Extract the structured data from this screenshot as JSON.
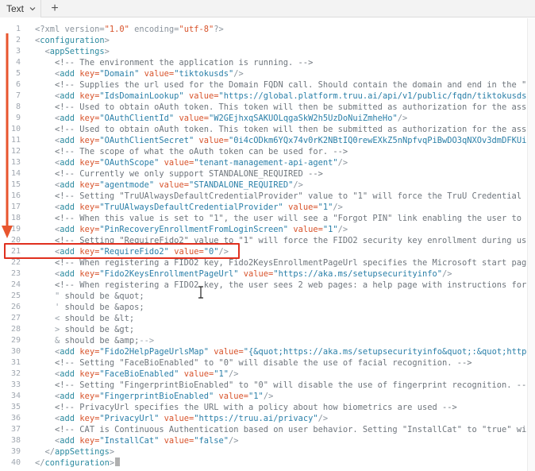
{
  "tab": {
    "label": "Text",
    "add_label": "+"
  },
  "colors": {
    "annotation": "#e0301e",
    "tag": "#2b8aa0",
    "attr": "#d8532b",
    "value": "#2a7fa8"
  },
  "editor": {
    "lines": [
      {
        "n": "1",
        "tokens": [
          {
            "c": "decl",
            "t": "<?xml version="
          },
          {
            "c": "str",
            "t": "\"1.0\""
          },
          {
            "c": "decl",
            "t": " encoding="
          },
          {
            "c": "str",
            "t": "\"utf-8\""
          },
          {
            "c": "decl",
            "t": "?>"
          }
        ]
      },
      {
        "n": "2",
        "tokens": [
          {
            "c": "punc",
            "t": "<"
          },
          {
            "c": "tag",
            "t": "configuration"
          },
          {
            "c": "punc",
            "t": ">"
          }
        ]
      },
      {
        "n": "3",
        "tokens": [
          {
            "c": "punc",
            "t": "  <"
          },
          {
            "c": "tag",
            "t": "appSettings"
          },
          {
            "c": "punc",
            "t": ">"
          }
        ]
      },
      {
        "n": "4",
        "tokens": [
          {
            "c": "comment",
            "t": "    <!-- The environment the application is running. -->"
          }
        ]
      },
      {
        "n": "5",
        "tokens": [
          {
            "c": "punc",
            "t": "    <"
          },
          {
            "c": "tag",
            "t": "add"
          },
          {
            "c": "attr",
            "t": " key="
          },
          {
            "c": "val",
            "t": "\"Domain\""
          },
          {
            "c": "attr",
            "t": " value="
          },
          {
            "c": "val",
            "t": "\"tiktokusds\""
          },
          {
            "c": "punc",
            "t": "/>"
          }
        ]
      },
      {
        "n": "6",
        "tokens": [
          {
            "c": "comment",
            "t": "    <!-- Supplies the url used for the Domain FQDN call. Should contain the domain and end in the \""
          }
        ]
      },
      {
        "n": "7",
        "tokens": [
          {
            "c": "punc",
            "t": "    <"
          },
          {
            "c": "tag",
            "t": "add"
          },
          {
            "c": "attr",
            "t": " key="
          },
          {
            "c": "val",
            "t": "\"IdsDomainLookup\""
          },
          {
            "c": "attr",
            "t": " value="
          },
          {
            "c": "val",
            "t": "\"https://global.platform.truu.ai/api/v1/public/fqdn/tiktokusds"
          }
        ]
      },
      {
        "n": "8",
        "tokens": [
          {
            "c": "comment",
            "t": "    <!-- Used to obtain oAuth token. This token will then be submitted as authorization for the ass"
          }
        ]
      },
      {
        "n": "9",
        "tokens": [
          {
            "c": "punc",
            "t": "    <"
          },
          {
            "c": "tag",
            "t": "add"
          },
          {
            "c": "attr",
            "t": " key="
          },
          {
            "c": "val",
            "t": "\"OAuthClientId\""
          },
          {
            "c": "attr",
            "t": " value="
          },
          {
            "c": "val",
            "t": "\"W2GEjhxqSAKUOLqgaSkW2h5UzDoNuiZmheHo\""
          },
          {
            "c": "punc",
            "t": "/>"
          }
        ]
      },
      {
        "n": "10",
        "tokens": [
          {
            "c": "comment",
            "t": "    <!-- Used to obtain oAuth token. This token will then be submitted as authorization for the ass"
          }
        ]
      },
      {
        "n": "11",
        "tokens": [
          {
            "c": "punc",
            "t": "    <"
          },
          {
            "c": "tag",
            "t": "add"
          },
          {
            "c": "attr",
            "t": " key="
          },
          {
            "c": "val",
            "t": "\"OAuthClientSecret\""
          },
          {
            "c": "attr",
            "t": " value="
          },
          {
            "c": "val",
            "t": "\"0i4cODkm6YQx74v0rK2NBtIQ0rewEXkZ5nNpfvqPiBwDO3qNXOv3dmDFKUi"
          }
        ]
      },
      {
        "n": "12",
        "tokens": [
          {
            "c": "comment",
            "t": "    <!-- The scope of what the oAuth token can be used for. -->"
          }
        ]
      },
      {
        "n": "13",
        "tokens": [
          {
            "c": "punc",
            "t": "    <"
          },
          {
            "c": "tag",
            "t": "add"
          },
          {
            "c": "attr",
            "t": " key="
          },
          {
            "c": "val",
            "t": "\"OAuthScope\""
          },
          {
            "c": "attr",
            "t": " value="
          },
          {
            "c": "val",
            "t": "\"tenant-management-api-agent\""
          },
          {
            "c": "punc",
            "t": "/>"
          }
        ]
      },
      {
        "n": "14",
        "tokens": [
          {
            "c": "comment",
            "t": "    <!-- Currently we only support STANDALONE_REQUIRED -->"
          }
        ]
      },
      {
        "n": "15",
        "tokens": [
          {
            "c": "punc",
            "t": "    <"
          },
          {
            "c": "tag",
            "t": "add"
          },
          {
            "c": "attr",
            "t": " key="
          },
          {
            "c": "val",
            "t": "\"agentmode\""
          },
          {
            "c": "attr",
            "t": " value="
          },
          {
            "c": "val",
            "t": "\"STANDALONE_REQUIRED\""
          },
          {
            "c": "punc",
            "t": "/>"
          }
        ]
      },
      {
        "n": "16",
        "tokens": [
          {
            "c": "comment",
            "t": "    <!-- Setting \"TruUAlwaysDefaultCredentialProvider\" value to \"1\" will force the TruU Credential P"
          }
        ]
      },
      {
        "n": "17",
        "tokens": [
          {
            "c": "punc",
            "t": "    <"
          },
          {
            "c": "tag",
            "t": "add"
          },
          {
            "c": "attr",
            "t": " key="
          },
          {
            "c": "val",
            "t": "\"TruUAlwaysDefaultCredentialProvider\""
          },
          {
            "c": "attr",
            "t": " value="
          },
          {
            "c": "val",
            "t": "\"1\""
          },
          {
            "c": "punc",
            "t": "/>"
          }
        ]
      },
      {
        "n": "18",
        "tokens": [
          {
            "c": "comment",
            "t": "    <!-- When this value is set to \"1\", the user will see a \"Forgot PIN\" link enabling the user to"
          }
        ]
      },
      {
        "n": "19",
        "tokens": [
          {
            "c": "punc",
            "t": "    <"
          },
          {
            "c": "tag",
            "t": "add"
          },
          {
            "c": "attr",
            "t": " key="
          },
          {
            "c": "val",
            "t": "\"PinRecoveryEnrollmentFromLoginScreen\""
          },
          {
            "c": "attr",
            "t": " value="
          },
          {
            "c": "val",
            "t": "\"1\""
          },
          {
            "c": "punc",
            "t": "/>"
          }
        ]
      },
      {
        "n": "20",
        "tokens": [
          {
            "c": "comment",
            "t": "    <!-- Setting \"RequireFido2\" value to \"1\" will force the FIDO2 security key enrollment during us"
          }
        ]
      },
      {
        "n": "21",
        "tokens": [
          {
            "c": "punc",
            "t": "    <"
          },
          {
            "c": "tag",
            "t": "add"
          },
          {
            "c": "attr",
            "t": " key="
          },
          {
            "c": "val",
            "t": "\"RequireFido2\""
          },
          {
            "c": "attr",
            "t": " value="
          },
          {
            "c": "val",
            "t": "\"0\""
          },
          {
            "c": "punc",
            "t": "/>"
          }
        ]
      },
      {
        "n": "22",
        "tokens": [
          {
            "c": "comment",
            "t": "    <!-- When registering a FIDO2 key, Fido2KeysEnrollmentPageUrl specifies the Microsoft start pag"
          }
        ]
      },
      {
        "n": "23",
        "tokens": [
          {
            "c": "punc",
            "t": "    <"
          },
          {
            "c": "tag",
            "t": "add"
          },
          {
            "c": "attr",
            "t": " key="
          },
          {
            "c": "val",
            "t": "\"Fido2KeysEnrollmentPageUrl\""
          },
          {
            "c": "attr",
            "t": " value="
          },
          {
            "c": "val",
            "t": "\"https://aka.ms/setupsecurityinfo\""
          },
          {
            "c": "punc",
            "t": "/>"
          }
        ]
      },
      {
        "n": "24",
        "tokens": [
          {
            "c": "comment",
            "t": "    <!-- When registering a FIDO2 key, the user sees 2 web pages: a help page with instructions for"
          }
        ]
      },
      {
        "n": "25",
        "tokens": [
          {
            "c": "ent",
            "t": "    \""
          },
          {
            "c": "comment",
            "t": " should be &quot;"
          }
        ]
      },
      {
        "n": "26",
        "tokens": [
          {
            "c": "ent",
            "t": "    '"
          },
          {
            "c": "comment",
            "t": " should be &apos;"
          }
        ]
      },
      {
        "n": "27",
        "tokens": [
          {
            "c": "ent",
            "t": "    <"
          },
          {
            "c": "comment",
            "t": " should be &lt;"
          }
        ]
      },
      {
        "n": "28",
        "tokens": [
          {
            "c": "ent",
            "t": "    >"
          },
          {
            "c": "comment",
            "t": " should be &gt;"
          }
        ]
      },
      {
        "n": "29",
        "tokens": [
          {
            "c": "ent",
            "t": "    &"
          },
          {
            "c": "comment",
            "t": " should be &amp;"
          },
          {
            "c": "ent",
            "t": "-->"
          }
        ]
      },
      {
        "n": "30",
        "tokens": [
          {
            "c": "punc",
            "t": "    <"
          },
          {
            "c": "tag",
            "t": "add"
          },
          {
            "c": "attr",
            "t": " key="
          },
          {
            "c": "val",
            "t": "\"Fido2HelpPageUrlsMap\""
          },
          {
            "c": "attr",
            "t": " value="
          },
          {
            "c": "val",
            "t": "\"{&quot;https://aka.ms/setupsecurityinfo&quot;:&quot;http"
          }
        ]
      },
      {
        "n": "31",
        "tokens": [
          {
            "c": "comment",
            "t": "    <!-- Setting \"FaceBioEnabled\" to \"0\" will disable the use of facial recognition. -->"
          }
        ]
      },
      {
        "n": "32",
        "tokens": [
          {
            "c": "punc",
            "t": "    <"
          },
          {
            "c": "tag",
            "t": "add"
          },
          {
            "c": "attr",
            "t": " key="
          },
          {
            "c": "val",
            "t": "\"FaceBioEnabled\""
          },
          {
            "c": "attr",
            "t": " value="
          },
          {
            "c": "val",
            "t": "\"1\""
          },
          {
            "c": "punc",
            "t": "/>"
          }
        ]
      },
      {
        "n": "33",
        "tokens": [
          {
            "c": "comment",
            "t": "    <!-- Setting \"FingerprintBioEnabled\" to \"0\" will disable the use of fingerprint recognition. --"
          }
        ]
      },
      {
        "n": "34",
        "tokens": [
          {
            "c": "punc",
            "t": "    <"
          },
          {
            "c": "tag",
            "t": "add"
          },
          {
            "c": "attr",
            "t": " key="
          },
          {
            "c": "val",
            "t": "\"FingerprintBioEnabled\""
          },
          {
            "c": "attr",
            "t": " value="
          },
          {
            "c": "val",
            "t": "\"1\""
          },
          {
            "c": "punc",
            "t": "/>"
          }
        ]
      },
      {
        "n": "35",
        "tokens": [
          {
            "c": "comment",
            "t": "    <!-- PrivacyUrl specifies the URL with a policy about how biometrics are used -->"
          }
        ]
      },
      {
        "n": "36",
        "tokens": [
          {
            "c": "punc",
            "t": "    <"
          },
          {
            "c": "tag",
            "t": "add"
          },
          {
            "c": "attr",
            "t": " key="
          },
          {
            "c": "val",
            "t": "\"PrivacyUrl\""
          },
          {
            "c": "attr",
            "t": " value="
          },
          {
            "c": "val",
            "t": "\"https://truu.ai/privacy\""
          },
          {
            "c": "punc",
            "t": "/>"
          }
        ]
      },
      {
        "n": "37",
        "tokens": [
          {
            "c": "comment",
            "t": "    <!-- CAT is Continuous Authentication based on user behavior. Setting \"InstallCat\" to \"true\" wi"
          }
        ]
      },
      {
        "n": "38",
        "tokens": [
          {
            "c": "punc",
            "t": "    <"
          },
          {
            "c": "tag",
            "t": "add"
          },
          {
            "c": "attr",
            "t": " key="
          },
          {
            "c": "val",
            "t": "\"InstallCat\""
          },
          {
            "c": "attr",
            "t": " value="
          },
          {
            "c": "val",
            "t": "\"false\""
          },
          {
            "c": "punc",
            "t": "/>"
          }
        ]
      },
      {
        "n": "39",
        "tokens": [
          {
            "c": "punc",
            "t": "  </"
          },
          {
            "c": "tag",
            "t": "appSettings"
          },
          {
            "c": "punc",
            "t": ">"
          }
        ]
      },
      {
        "n": "40",
        "tokens": [
          {
            "c": "punc",
            "t": "</"
          },
          {
            "c": "tag",
            "t": "configuration"
          },
          {
            "c": "punc",
            "t": ">"
          }
        ]
      }
    ]
  }
}
